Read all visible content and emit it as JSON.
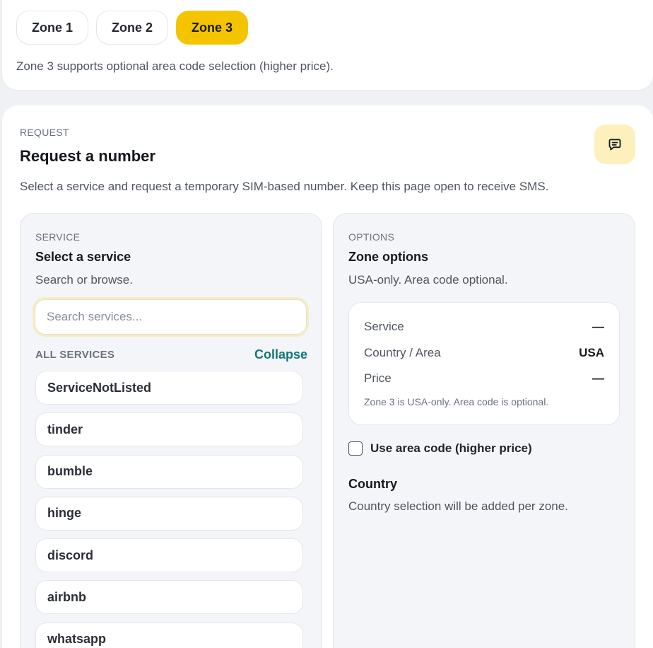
{
  "zones": {
    "tabs": [
      {
        "label": "Zone 1"
      },
      {
        "label": "Zone 2"
      },
      {
        "label": "Zone 3"
      }
    ],
    "active_index": 2,
    "note": "Zone 3 supports optional area code selection (higher price)."
  },
  "request": {
    "eyebrow": "REQUEST",
    "title": "Request a number",
    "description": "Select a service and request a temporary SIM-based number. Keep this page open to receive SMS.",
    "chat_icon": "message-square-icon"
  },
  "service": {
    "eyebrow": "SERVICE",
    "title": "Select a service",
    "subtitle": "Search or browse.",
    "search_placeholder": "Search services...",
    "all_label": "ALL SERVICES",
    "collapse_label": "Collapse",
    "items": [
      {
        "label": "ServiceNotListed"
      },
      {
        "label": "tinder"
      },
      {
        "label": "bumble"
      },
      {
        "label": "hinge"
      },
      {
        "label": "discord"
      },
      {
        "label": "airbnb"
      },
      {
        "label": "whatsapp"
      }
    ]
  },
  "options": {
    "eyebrow": "OPTIONS",
    "title": "Zone options",
    "subtitle": "USA-only. Area code optional.",
    "summary": {
      "service_label": "Service",
      "service_value": "—",
      "country_label": "Country / Area",
      "country_value": "USA",
      "price_label": "Price",
      "price_value": "—",
      "note": "Zone 3 is USA-only. Area code is optional."
    },
    "area_code_label": "Use area code (higher price)",
    "area_code_checked": false,
    "country_title": "Country",
    "country_desc": "Country selection will be added per zone."
  },
  "colors": {
    "accent": "#f5c400",
    "link": "#13757a",
    "chat_bg": "#fdf0bd"
  }
}
